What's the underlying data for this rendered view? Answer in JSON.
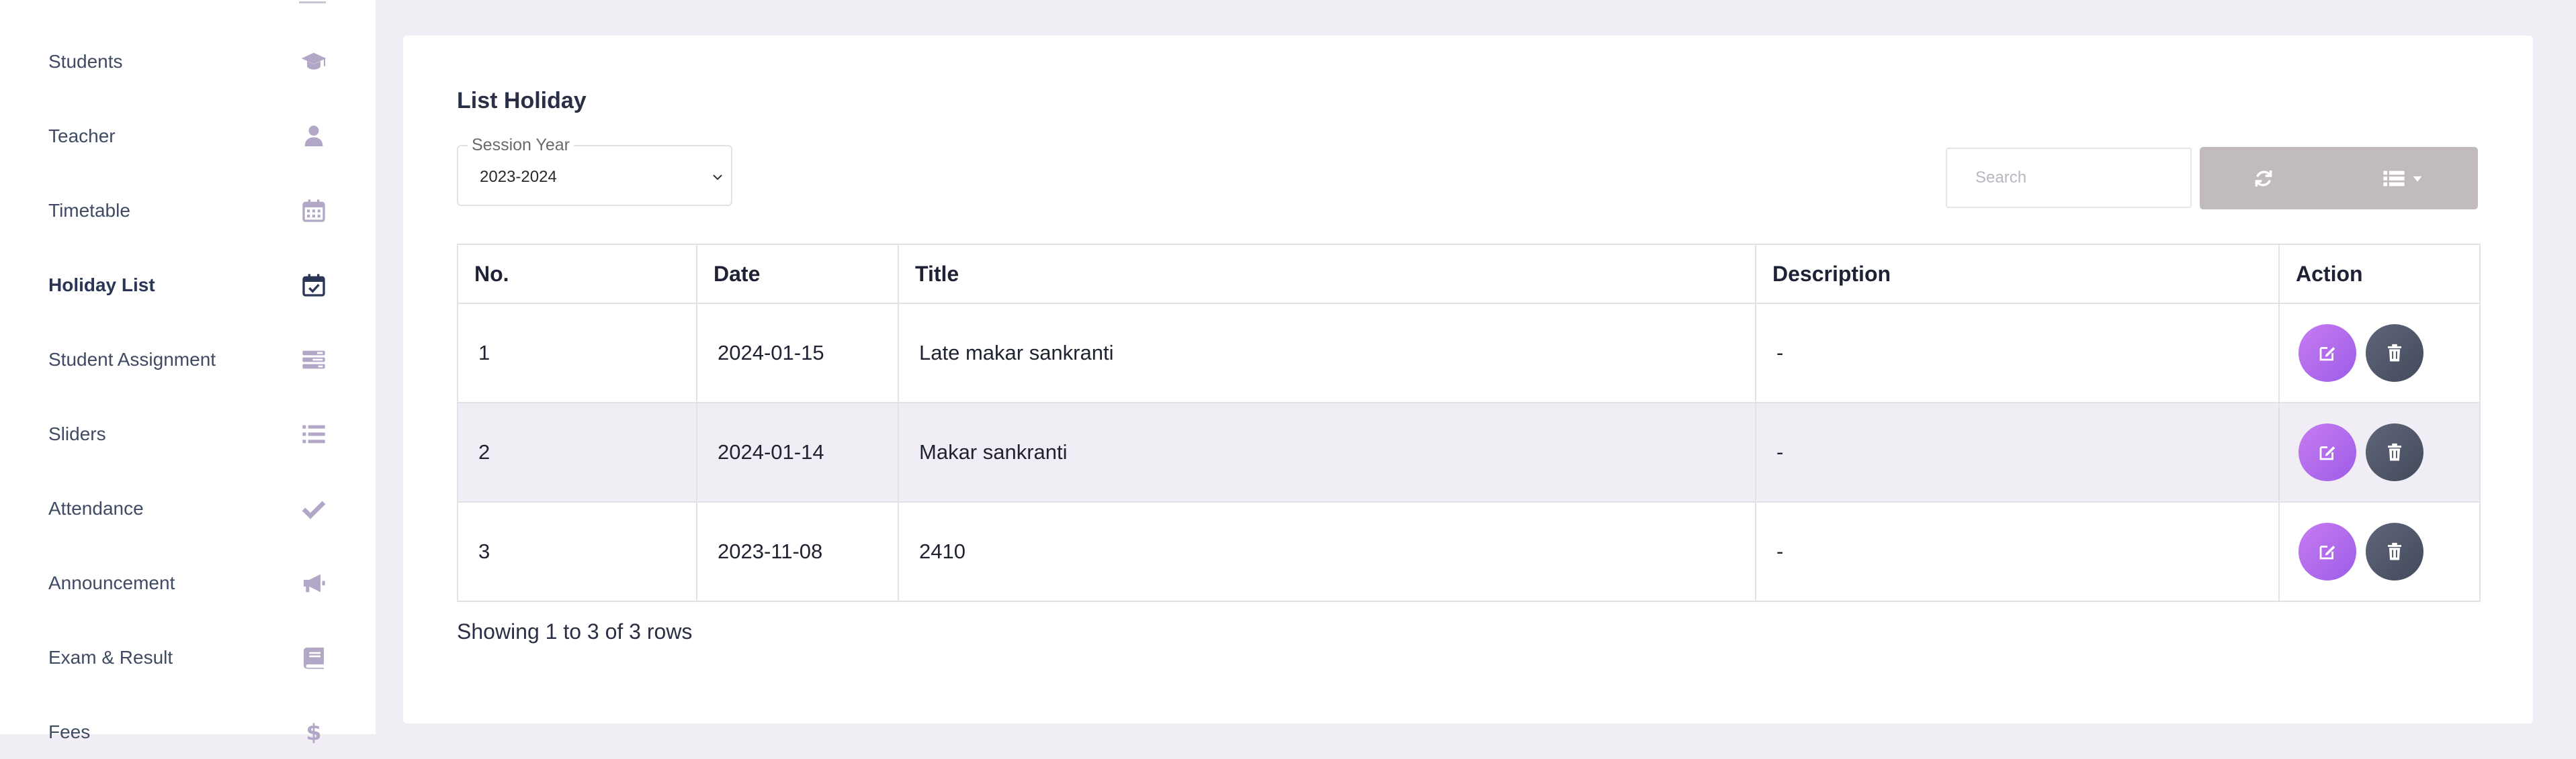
{
  "sidebar": {
    "items": [
      {
        "label": "Students",
        "icon": "graduation-cap-icon",
        "active": false
      },
      {
        "label": "Teacher",
        "icon": "user-icon",
        "active": false
      },
      {
        "label": "Timetable",
        "icon": "calendar-icon",
        "active": false
      },
      {
        "label": "Holiday List",
        "icon": "calendar-check-icon",
        "active": true
      },
      {
        "label": "Student Assignment",
        "icon": "tasks-icon",
        "active": false
      },
      {
        "label": "Sliders",
        "icon": "list-icon",
        "active": false
      },
      {
        "label": "Attendance",
        "icon": "check-icon",
        "active": false
      },
      {
        "label": "Announcement",
        "icon": "bullhorn-icon",
        "active": false
      },
      {
        "label": "Exam & Result",
        "icon": "book-icon",
        "active": false
      },
      {
        "label": "Fees",
        "icon": "dollar-icon",
        "active": false
      }
    ]
  },
  "main": {
    "title": "List Holiday",
    "session_year": {
      "label": "Session Year",
      "value": "2023-2024"
    },
    "search": {
      "placeholder": "Search"
    },
    "table": {
      "columns": [
        "No.",
        "Date",
        "Title",
        "Description",
        "Action"
      ],
      "rows": [
        {
          "no": "1",
          "date": "2024-01-15",
          "title": "Late makar sankranti",
          "description": "-"
        },
        {
          "no": "2",
          "date": "2024-01-14",
          "title": "Makar sankranti",
          "description": "-"
        },
        {
          "no": "3",
          "date": "2023-11-08",
          "title": "2410",
          "description": "-"
        }
      ]
    },
    "pagination_info": "Showing 1 to 3 of 3 rows"
  },
  "colors": {
    "page_bg": "#f0eef4",
    "edit_button": "#b36cf0",
    "delete_button": "#4e5568",
    "toolbar_button": "#c1bbbd",
    "sidebar_icon": "#b2a7c6",
    "sidebar_active": "#2b3656"
  }
}
